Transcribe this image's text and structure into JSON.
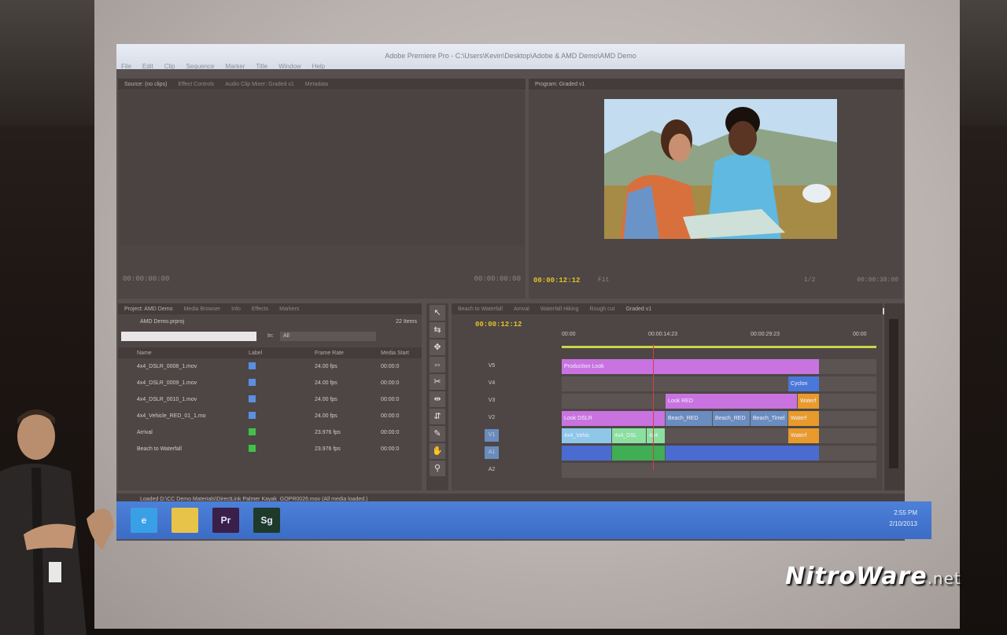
{
  "app": {
    "title": "Adobe Premiere Pro - C:\\Users\\Kevin\\Desktop\\Adobe & AMD Demo\\AMD Demo",
    "menu": [
      "File",
      "Edit",
      "Clip",
      "Sequence",
      "Marker",
      "Title",
      "Window",
      "Help"
    ]
  },
  "source_panel": {
    "tabs": [
      "Source: (no clips)",
      "Effect Controls",
      "Audio Clip Mixer: Graded v1",
      "Metadata"
    ],
    "timecode_left": "00:00:00:00",
    "timecode_right": "00:00:00:00"
  },
  "program_panel": {
    "tab": "Program: Graded v1",
    "timecode": "00:00:12:12",
    "zoom": "Fit",
    "quality": "1/2",
    "duration": "00:00:38:00"
  },
  "project_panel": {
    "tabs": [
      "Project: AMD Demo",
      "Media Browser",
      "Info",
      "Effects",
      "Markers"
    ],
    "file": "AMD Demo.prproj",
    "item_count": "22 Items",
    "in_label": "In:",
    "in_value": "All",
    "columns": [
      "Name",
      "Label",
      "Frame Rate",
      "Media Start"
    ],
    "items": [
      {
        "name": "4x4_DSLR_0008_1.mov",
        "label_color": "#5b8fe0",
        "rate": "24.00 fps",
        "start": "00:00:0"
      },
      {
        "name": "4x4_DSLR_0009_1.mov",
        "label_color": "#5b8fe0",
        "rate": "24.00 fps",
        "start": "00:00:0"
      },
      {
        "name": "4x4_DSLR_0010_1.mov",
        "label_color": "#5b8fe0",
        "rate": "24.00 fps",
        "start": "00:00:0"
      },
      {
        "name": "4x4_Vehicle_RED_01_1.mo",
        "label_color": "#5b8fe0",
        "rate": "24.00 fps",
        "start": "00:00:0"
      },
      {
        "name": "Arrival",
        "label_color": "#41c04a",
        "rate": "23.976 fps",
        "start": "00:00:0"
      },
      {
        "name": "Beach to Waterfall",
        "label_color": "#41c04a",
        "rate": "23.976 fps",
        "start": "00:00:0"
      }
    ]
  },
  "timeline_panel": {
    "tabs": [
      "Beach to Waterfall",
      "Arrival",
      "Waterfall Hiking",
      "Rough cut",
      "Graded v1"
    ],
    "timecode": "00:00:12:12",
    "ruler": [
      "00:00",
      "00:00:14:23",
      "00:00:29:23",
      "00:00"
    ],
    "tracks": [
      {
        "name": "V5",
        "clips": [
          {
            "label": "Production Look",
            "color": "#c873e0",
            "start": 0.0,
            "end": 0.82
          }
        ]
      },
      {
        "name": "V4",
        "clips": [
          {
            "label": "Cyclon",
            "color": "#4a78d8",
            "start": 0.72,
            "end": 0.82
          }
        ]
      },
      {
        "name": "V3",
        "clips": [
          {
            "label": "Look RED",
            "color": "#c873e0",
            "start": 0.33,
            "end": 0.75
          },
          {
            "label": "Waterf",
            "color": "#e89a2c",
            "start": 0.75,
            "end": 0.82
          }
        ]
      },
      {
        "name": "V2",
        "clips": [
          {
            "label": "Look DSLR",
            "color": "#c873e0",
            "start": 0.0,
            "end": 0.33
          },
          {
            "label": "Beach_RED",
            "color": "#6a8cbf",
            "start": 0.33,
            "end": 0.48
          },
          {
            "label": "Beach_RED",
            "color": "#6a8cbf",
            "start": 0.48,
            "end": 0.6
          },
          {
            "label": "Beach_Timel",
            "color": "#6a8cbf",
            "start": 0.6,
            "end": 0.72
          },
          {
            "label": "Waterf",
            "color": "#e89a2c",
            "start": 0.72,
            "end": 0.82
          }
        ]
      },
      {
        "name": "V1",
        "clips": [
          {
            "label": "4x4_Vehic",
            "color": "#8ec7e8",
            "start": 0.0,
            "end": 0.16
          },
          {
            "label": "4x4_DSL",
            "color": "#8be0a0",
            "start": 0.16,
            "end": 0.27
          },
          {
            "label": "4x4",
            "color": "#8be0a0",
            "start": 0.27,
            "end": 0.33
          },
          {
            "label": "Waterf",
            "color": "#e89a2c",
            "start": 0.72,
            "end": 0.82
          }
        ]
      },
      {
        "name": "A1",
        "clips": [
          {
            "label": "",
            "color": "#4a6bd0",
            "start": 0.0,
            "end": 0.16
          },
          {
            "label": "",
            "color": "#3fae55",
            "start": 0.16,
            "end": 0.33
          },
          {
            "label": "",
            "color": "#4a6bd0",
            "start": 0.33,
            "end": 0.82
          }
        ]
      },
      {
        "name": "A2",
        "clips": []
      }
    ]
  },
  "status": "Loaded D:\\CC Demo Materials\\DirectLink Palmer Kayak_GOPR0026.mov (All media loaded.)",
  "taskbar": {
    "apps": [
      {
        "name": "ie-icon",
        "color": "#3aa0e6",
        "glyph": "e"
      },
      {
        "name": "explorer-icon",
        "color": "#e8c34a",
        "glyph": ""
      },
      {
        "name": "premiere-icon",
        "color": "#3a1f4a",
        "glyph": "Pr"
      },
      {
        "name": "speedgrade-icon",
        "color": "#1e3a2a",
        "glyph": "Sg"
      }
    ],
    "time": "2:55 PM",
    "date": "2/10/2013"
  },
  "watermark": {
    "brand": "NitroWare",
    "suffix": ".net"
  }
}
